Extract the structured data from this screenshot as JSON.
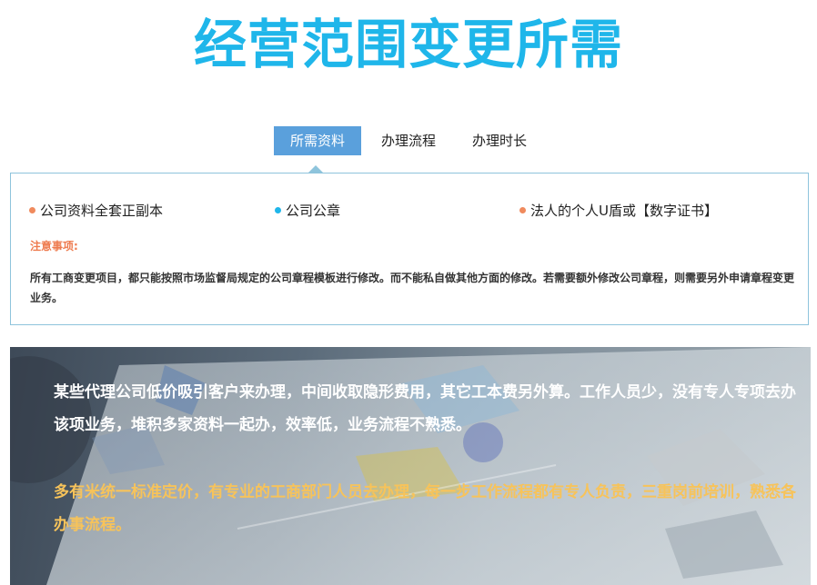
{
  "page": {
    "title": "经营范围变更所需"
  },
  "tabs": [
    {
      "label": "所需资料",
      "active": true
    },
    {
      "label": "办理流程",
      "active": false
    },
    {
      "label": "办理时长",
      "active": false
    }
  ],
  "requirements": [
    {
      "label": "公司资料全套正副本",
      "dot_color": "#f08a5d"
    },
    {
      "label": "公司公章",
      "dot_color": "#1fb6ea"
    },
    {
      "label": "法人的个人U盾或【数字证书】",
      "dot_color": "#f08a5d"
    }
  ],
  "notice": {
    "title": "注意事项:",
    "body": "所有工商变更项目，都只能按照市场监督局规定的公司章程模板进行修改。而不能私自做其他方面的修改。若需要额外修改公司章程，则需要另外申请章程变更业务。"
  },
  "banner": {
    "problem_text": "某些代理公司低价吸引客户来办理，中间收取隐形费用，其它工本费另外算。工作人员少，没有专人专项去办该项业务，堆积多家资料一起办，效率低，业务流程不熟悉。",
    "solution_text": "多有米统一标准定价，有专业的工商部门人员去办理，每一步工作流程都有专人负责，三重岗前培训，熟悉各办事流程。"
  },
  "colors": {
    "title": "#1fb6ea",
    "tab_active": "#5aa0dc",
    "notice_title": "#ee7b4f",
    "banner_highlight": "#f7c35a"
  }
}
